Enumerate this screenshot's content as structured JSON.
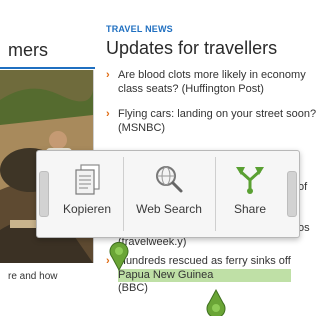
{
  "left_panel": {
    "heading": "mers",
    "caption": "re and how"
  },
  "article": {
    "category": "TRAVEL NEWS",
    "title": "Updates for travellers"
  },
  "news": [
    {
      "lines": [
        "Are blood clots more likely in economy",
        "class seats? (Huffington Post)"
      ]
    },
    {
      "lines": [
        "Flying cars: landing on your street soon?",
        "(MSNBC)"
      ]
    },
    {
      "lines": [
        "of"
      ]
    },
    {
      "lines": [
        "os"
      ]
    },
    {
      "lines": [
        "(travelweek.y)"
      ]
    },
    {
      "lines": [
        "Hundreds rescued as ferry sinks off"
      ]
    }
  ],
  "last_line": {
    "highlighted": "Papua New Guinea",
    "rest": " (BBC)"
  },
  "popup": {
    "items": [
      {
        "label": "Kopieren",
        "icon": "copy-icon"
      },
      {
        "label": "Web Search",
        "icon": "web-search-icon"
      },
      {
        "label": "Share",
        "icon": "share-icon"
      }
    ]
  },
  "colors": {
    "accent_blue": "#1f6fc0",
    "bullet_orange": "#e06a10",
    "selection_green": "#bfe0a6",
    "handle_green": "#6aa536"
  }
}
